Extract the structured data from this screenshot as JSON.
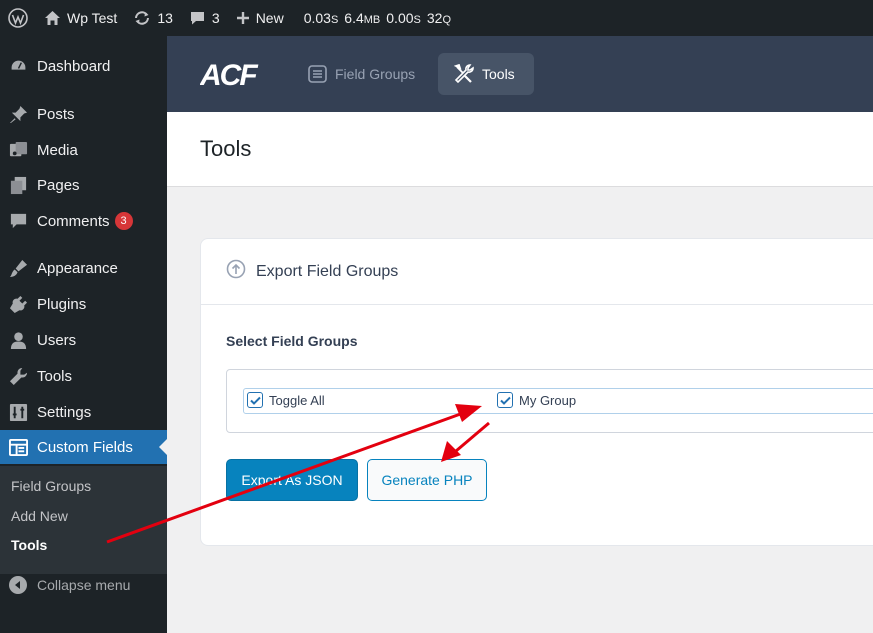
{
  "adminbar": {
    "site_name": "Wp Test",
    "updates_count": "13",
    "comments_count": "3",
    "new_label": "New",
    "stats": {
      "time1": "0.03",
      "time1_unit": "S",
      "memory": "6.4",
      "memory_unit": "MB",
      "time2": "0.00",
      "time2_unit": "S",
      "queries": "32",
      "queries_unit": "Q"
    }
  },
  "sidebar": {
    "items": [
      {
        "label": "Dashboard",
        "icon": "dashboard-icon"
      },
      {
        "label": "Posts",
        "icon": "pin-icon"
      },
      {
        "label": "Media",
        "icon": "media-icon"
      },
      {
        "label": "Pages",
        "icon": "pages-icon"
      },
      {
        "label": "Comments",
        "icon": "comment-icon",
        "badge": "3"
      },
      {
        "label": "Appearance",
        "icon": "brush-icon"
      },
      {
        "label": "Plugins",
        "icon": "plug-icon"
      },
      {
        "label": "Users",
        "icon": "user-icon"
      },
      {
        "label": "Tools",
        "icon": "wrench-icon"
      },
      {
        "label": "Settings",
        "icon": "sliders-icon"
      },
      {
        "label": "Custom Fields",
        "icon": "fields-icon"
      }
    ],
    "submenu": [
      "Field Groups",
      "Add New",
      "Tools"
    ],
    "collapse_label": "Collapse menu"
  },
  "acf": {
    "logo": "ACF",
    "tabs": [
      {
        "label": "Field Groups",
        "icon": "list-icon"
      },
      {
        "label": "Tools",
        "icon": "tools-icon"
      }
    ]
  },
  "page": {
    "title": "Tools"
  },
  "card": {
    "title": "Export Field Groups",
    "field_label": "Select Field Groups",
    "options": [
      {
        "label": "Toggle All",
        "checked": true
      },
      {
        "label": "My Group",
        "checked": true
      }
    ],
    "export_button": "Export As JSON",
    "generate_button": "Generate PHP"
  },
  "colors": {
    "accent": "#2271b1",
    "acf_header": "#344054",
    "button": "#0783be",
    "annotation_arrow": "#e3000f",
    "badge": "#d63638"
  }
}
